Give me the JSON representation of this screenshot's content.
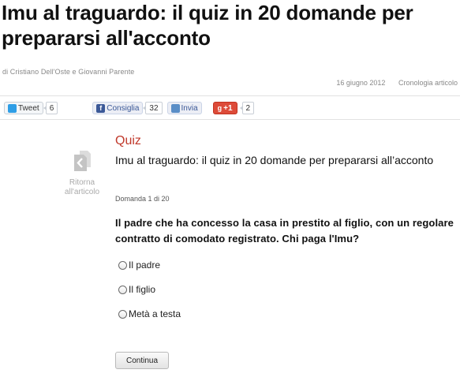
{
  "article": {
    "title": "Imu al traguardo: il quiz in 20 domande per prepararsi all'acconto",
    "byline": "di Cristiano Dell'Oste e Giovanni Parente",
    "date": "16 giugno 2012",
    "history_link": "Cronologia articolo"
  },
  "share": {
    "tweet_label": "Tweet",
    "tweet_count": "6",
    "like_label": "Consiglia",
    "like_count": "32",
    "send_label": "Invia",
    "gplus_label": "+1",
    "gplus_count": "2"
  },
  "sidebar": {
    "back_label_line1": "Ritorna",
    "back_label_line2": "all'articolo"
  },
  "quiz": {
    "section_label": "Quiz",
    "title": "Imu al traguardo: il quiz in 20 domande per prepararsi all’acconto",
    "counter": "Domanda 1 di 20",
    "question": "Il padre che ha concesso la casa in prestito al figlio, con un regolare contratto di comodato registrato. Chi paga l'Imu?",
    "options": [
      "Il padre",
      "Il figlio",
      "Metà a testa"
    ],
    "continue_label": "Continua"
  },
  "colors": {
    "quiz_accent": "#c0392b",
    "muted_text": "#888888",
    "twitter": "#2f9ee6",
    "facebook": "#3b5998",
    "gplus": "#dd4b39"
  },
  "icons": {
    "twitter": "twitter-bird-icon",
    "facebook": "facebook-f-icon",
    "send": "mail-icon",
    "gplus": "google-plus-icon",
    "back": "back-to-article-icon"
  }
}
